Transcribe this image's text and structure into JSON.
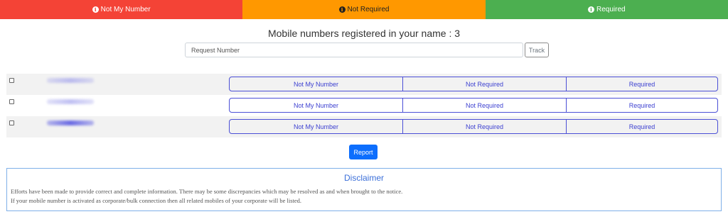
{
  "legend": [
    {
      "label": "Not My Number",
      "color": "#f44336",
      "icon": "info-icon"
    },
    {
      "label": "Not Required",
      "color": "#ff9800",
      "icon": "info-icon"
    },
    {
      "label": "Required",
      "color": "#4caf50",
      "icon": "info-icon"
    }
  ],
  "heading": "Mobile numbers registered in your name : 3",
  "search": {
    "placeholder": "Request Number",
    "value": "",
    "track_label": "Track"
  },
  "rows": [
    {
      "number_masked": true,
      "options": [
        "Not My Number",
        "Not Required",
        "Required"
      ]
    },
    {
      "number_masked": true,
      "options": [
        "Not My Number",
        "Not Required",
        "Required"
      ]
    },
    {
      "number_masked": true,
      "options": [
        "Not My Number",
        "Not Required",
        "Required"
      ]
    }
  ],
  "report_label": "Report",
  "disclaimer": {
    "title": "Disclaimer",
    "line1": "Efforts have been made to provide correct and complete information. There may be some discrepancies which may be resolved as and when brought to the notice.",
    "line2": "If your mobile number is activated as corporate/bulk connection then all related mobiles of your corporate will be listed."
  },
  "colors": {
    "accent": "#4b4fd6",
    "primary": "#0d6efd",
    "disclaimer_title": "#3b6fd9"
  }
}
